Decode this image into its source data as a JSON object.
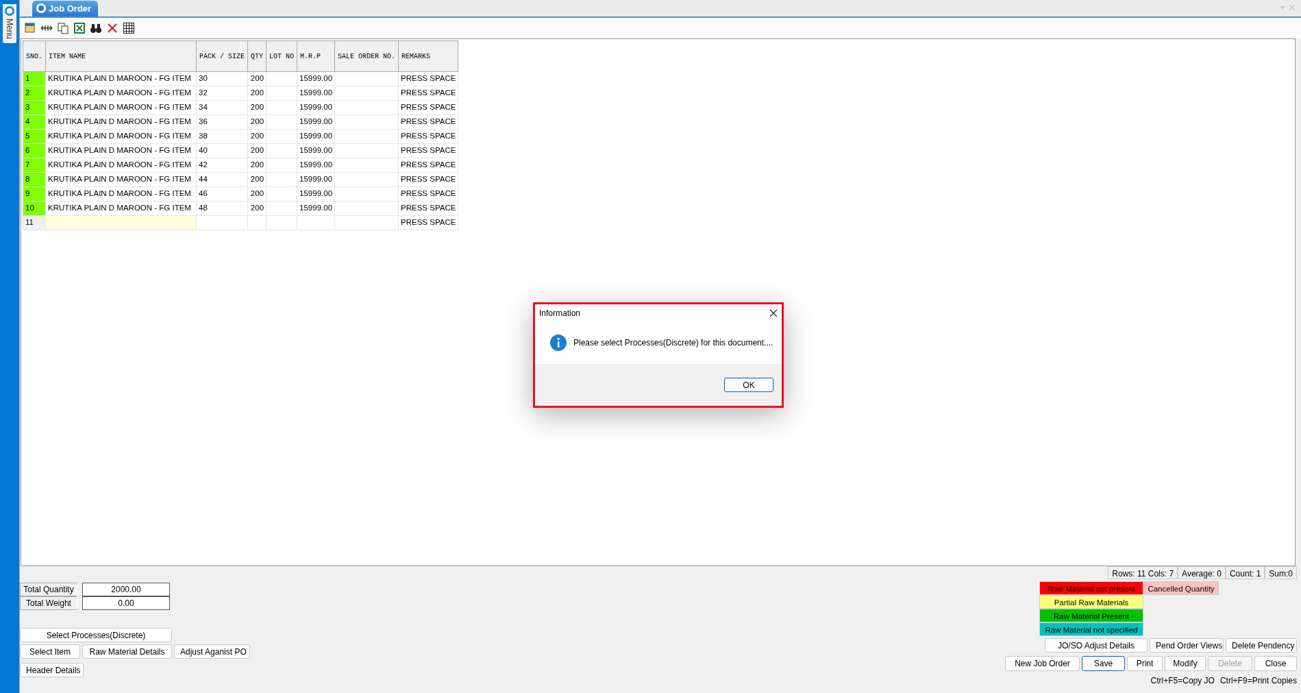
{
  "sidebar": {
    "label": "Menu"
  },
  "window": {
    "title": "Job Order"
  },
  "grid": {
    "columns": [
      "SNO.",
      "ITEM NAME",
      "PACK / SIZE",
      "QTY",
      "LOT NO",
      "M.R.P",
      "SALE ORDER NO.",
      "REMARKS"
    ],
    "rows": [
      {
        "sno": "1",
        "item_name": "KRUTIKA PLAIN D MAROON - FG ITEM",
        "pack_size": "30",
        "qty": "200",
        "mrp": "15999.00",
        "remarks": "PRESS SPACE",
        "color": "#80ff00",
        "selected": false
      },
      {
        "sno": "2",
        "item_name": "KRUTIKA PLAIN D MAROON - FG ITEM",
        "pack_size": "32",
        "qty": "200",
        "mrp": "15999.00",
        "remarks": "PRESS SPACE",
        "color": "#80ff00",
        "selected": false
      },
      {
        "sno": "3",
        "item_name": "KRUTIKA PLAIN D MAROON - FG ITEM",
        "pack_size": "34",
        "qty": "200",
        "mrp": "15999.00",
        "remarks": "PRESS SPACE",
        "color": "#80ff00",
        "selected": false
      },
      {
        "sno": "4",
        "item_name": "KRUTIKA PLAIN D MAROON - FG ITEM",
        "pack_size": "36",
        "qty": "200",
        "mrp": "15999.00",
        "remarks": "PRESS SPACE",
        "color": "#80ff00",
        "selected": false
      },
      {
        "sno": "5",
        "item_name": "KRUTIKA PLAIN D MAROON - FG ITEM",
        "pack_size": "38",
        "qty": "200",
        "mrp": "15999.00",
        "remarks": "PRESS SPACE",
        "color": "#80ff00",
        "selected": false
      },
      {
        "sno": "6",
        "item_name": "KRUTIKA PLAIN D MAROON - FG ITEM",
        "pack_size": "40",
        "qty": "200",
        "mrp": "15999.00",
        "remarks": "PRESS SPACE",
        "color": "#80ff00",
        "selected": false
      },
      {
        "sno": "7",
        "item_name": "KRUTIKA PLAIN D MAROON - FG ITEM",
        "pack_size": "42",
        "qty": "200",
        "mrp": "15999.00",
        "remarks": "PRESS SPACE",
        "color": "#80ff00",
        "selected": false
      },
      {
        "sno": "8",
        "item_name": "KRUTIKA PLAIN D MAROON - FG ITEM",
        "pack_size": "44",
        "qty": "200",
        "mrp": "15999.00",
        "remarks": "PRESS SPACE",
        "color": "#80ff00",
        "selected": false
      },
      {
        "sno": "9",
        "item_name": "KRUTIKA PLAIN D MAROON - FG ITEM",
        "pack_size": "46",
        "qty": "200",
        "mrp": "15999.00",
        "remarks": "PRESS SPACE",
        "color": "#80ff00",
        "selected": false
      },
      {
        "sno": "10",
        "item_name": "KRUTIKA PLAIN D MAROON - FG ITEM",
        "pack_size": "48",
        "qty": "200",
        "mrp": "15999.00",
        "remarks": "PRESS SPACE",
        "color": "#80ff00",
        "selected": false
      },
      {
        "sno": "11",
        "remarks": "PRESS SPACE",
        "color": "#f0f0f0",
        "selected": true
      }
    ]
  },
  "status_bar": [
    "Rows: 11  Cols: 7",
    "Average: 0",
    "Count: 1",
    "Sum:0"
  ],
  "totals": [
    {
      "label": "Total Quantity",
      "value": "2000.00"
    },
    {
      "label": "Total Weight",
      "value": "0.00"
    }
  ],
  "left_buttons": [
    [
      "Select Processes(Discrete)"
    ],
    [
      "Select Item",
      "Raw Material Details",
      "Adjust Aganist PO"
    ],
    [
      "Header Details"
    ]
  ],
  "legend": [
    {
      "label": "Raw Material not present",
      "color": "#ff0000"
    },
    {
      "label": "Cancelled Quantity",
      "color": "#ffc0c0"
    },
    {
      "label": "Partial Raw Materials",
      "color": "#ffff80"
    },
    {
      "label": "Raw Material Present",
      "color": "#00c000"
    },
    {
      "label": "Raw Material not specified",
      "color": "#00c0c0"
    }
  ],
  "right_buttons": [
    [
      {
        "label": "JO/SO Adjust Details",
        "disabled": false,
        "default": false
      },
      {
        "label": "Pend Order Views",
        "disabled": false,
        "default": false
      },
      {
        "label": "Delete Pendency",
        "disabled": false,
        "default": false
      }
    ],
    [
      {
        "label": "New Job Order",
        "disabled": false,
        "default": false
      },
      {
        "label": "Save",
        "disabled": false,
        "default": true
      },
      {
        "label": "Print",
        "disabled": false,
        "default": false
      },
      {
        "label": "Modify",
        "disabled": false,
        "default": false
      },
      {
        "label": "Delete",
        "disabled": true,
        "default": false
      },
      {
        "label": "Close",
        "disabled": false,
        "default": false
      }
    ]
  ],
  "shortcuts": [
    "Ctrl+F5=Copy JO",
    "Ctrl+F9=Print Copies"
  ],
  "dialog": {
    "title": "Information",
    "message": "Please select Processes(Discrete) for this document....",
    "button": "OK"
  }
}
